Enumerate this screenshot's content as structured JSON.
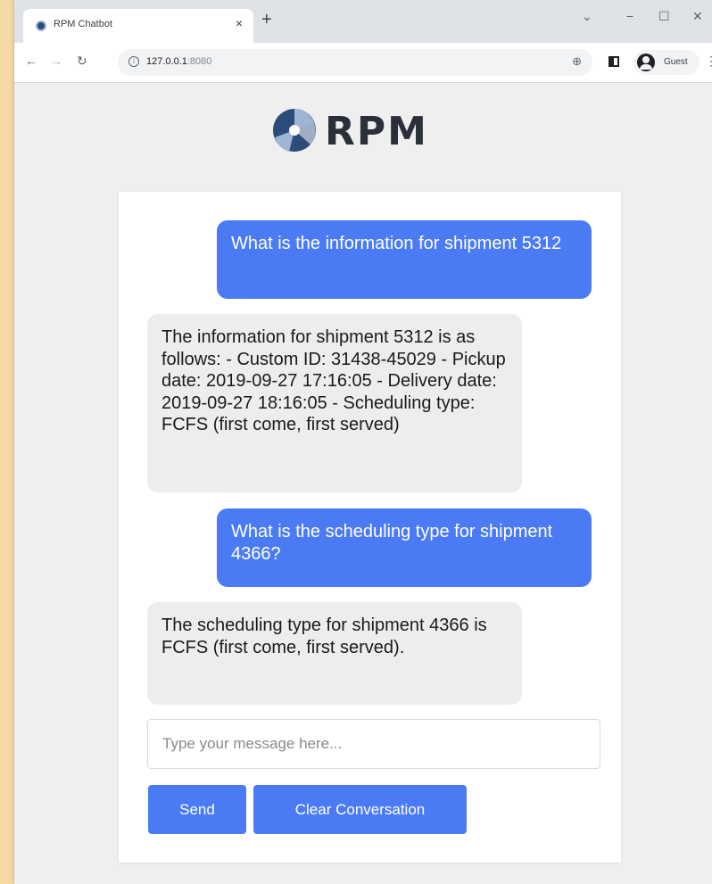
{
  "browser": {
    "tab_title": "RPM Chatbot",
    "tab_close": "×",
    "new_tab": "+",
    "window_controls": {
      "chevron": "⌄",
      "minimize": "−",
      "maximize": "☐",
      "close": "✕"
    },
    "nav": {
      "back": "←",
      "forward": "→",
      "reload": "↻"
    },
    "url_host": "127.0.0.1",
    "url_port": ":8080",
    "guest_label": "Guest",
    "menu": "⋮",
    "zoom": "⊕"
  },
  "brand": {
    "name": "RPM",
    "colors": {
      "dark": "#2c4d7a",
      "light": "#9fb6d3"
    }
  },
  "chat": {
    "messages": [
      {
        "role": "user",
        "text": "What is the information for shipment 5312"
      },
      {
        "role": "bot",
        "text": "The information for shipment 5312 is as follows: - Custom ID: 31438-45029 - Pickup date: 2019-09-27 17:16:05 - Delivery date: 2019-09-27 18:16:05 - Scheduling type: FCFS (first come, first served)"
      },
      {
        "role": "user",
        "text": "What is the scheduling type for shipment 4366?"
      },
      {
        "role": "bot",
        "text": "The scheduling type for shipment 4366 is FCFS (first come, first served)."
      }
    ],
    "input_placeholder": "Type your message here...",
    "send_label": "Send",
    "clear_label": "Clear Conversation"
  },
  "colors": {
    "user_bubble": "#4b7bf4",
    "bot_bubble": "#ededed",
    "button": "#4b7bf4"
  }
}
